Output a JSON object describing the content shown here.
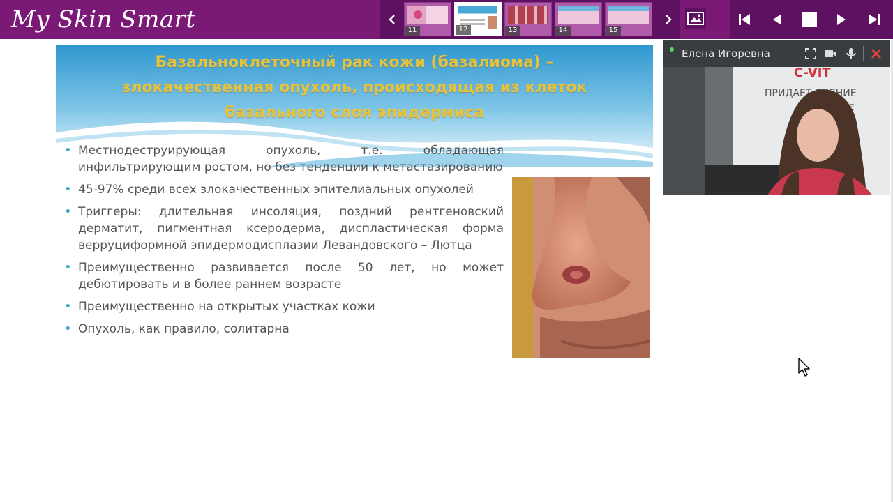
{
  "app": {
    "logo_text": "My Skin Smart"
  },
  "thumbnails": [
    {
      "number": "11",
      "active": false
    },
    {
      "number": "12",
      "active": true
    },
    {
      "number": "13",
      "active": false
    },
    {
      "number": "14",
      "active": false
    },
    {
      "number": "15",
      "active": false
    }
  ],
  "slide": {
    "title_lines": [
      "Базальноклеточный рак кожи (базалиома) –",
      "злокачественная опухоль, происходящая из клеток",
      "базального слоя эпидермиса"
    ],
    "bullets": [
      "Местнодеструирующая опухоль, т.е. обладающая инфильтрирующим ростом, но без тенденции к метастазированию",
      "45-97% среди всех злокачественных эпителиальных опухолей",
      "Триггеры: длительная инсоляция, поздний рентгеновский дерматит, пигментная ксеродерма, диспластическая форма верруциформной эпидермодисплазии Левандовского – Лютца",
      "Преимущественно развивается после 50 лет, но может дебютировать и в более раннем возрасте",
      "Преимущественно на открытых участках кожи",
      "Опухоль, как правило, солитарна"
    ]
  },
  "video": {
    "participant_name": "Елена Игоревна",
    "background_sign_lines": [
      "C-VIT",
      "ПРИДАЕТ СИЯНИЕ",
      "КОЖЕ"
    ]
  },
  "icons": {
    "prev_strip": "chevron-left-icon",
    "next_strip": "chevron-right-icon",
    "image": "image-icon",
    "first": "skip-first-icon",
    "prev": "prev-icon",
    "stop": "stop-icon",
    "play": "play-icon",
    "last": "skip-last-icon"
  },
  "colors": {
    "topbar": "#7a1a76",
    "strip": "#5e1160",
    "title": "#e8c23a",
    "bullet": "#3fa7c9",
    "close": "#e0453a"
  }
}
